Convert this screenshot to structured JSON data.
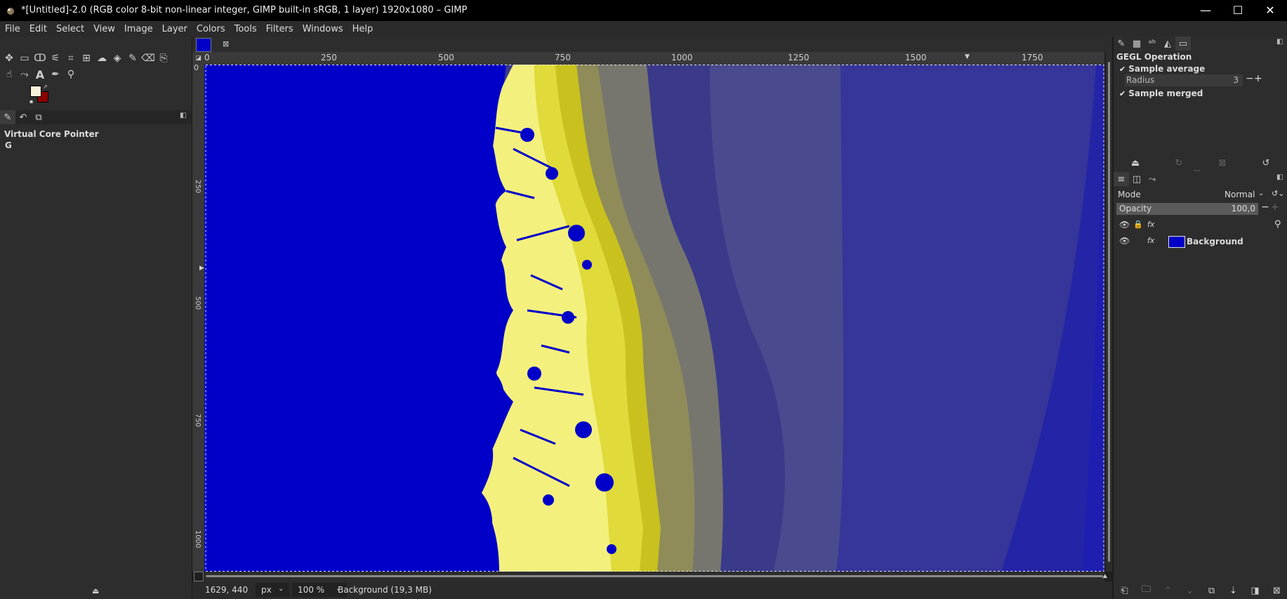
{
  "window": {
    "title": "*[Untitled]-2.0 (RGB color 8-bit non-linear integer, GIMP built-in sRGB, 1 layer) 1920x1080 – GIMP",
    "minimize": "—",
    "maximize": "☐",
    "close": "✕"
  },
  "menu": [
    "File",
    "Edit",
    "Select",
    "View",
    "Image",
    "Layer",
    "Colors",
    "Tools",
    "Filters",
    "Windows",
    "Help"
  ],
  "toolbox": {
    "device_status_title": "Virtual Core Pointer",
    "device_status_icon": "G"
  },
  "ruler": {
    "top_labels": [
      "0",
      "250",
      "500",
      "750",
      "1000",
      "1250",
      "1500",
      "1750"
    ],
    "left_labels": [
      "0",
      "250",
      "500",
      "750",
      "1000"
    ]
  },
  "status": {
    "coords": "1629, 440",
    "unit": "px",
    "zoom": "100 %",
    "layer_info": "Background (19,3 MB)"
  },
  "gegl": {
    "title": "GEGL Operation",
    "sample_average": "Sample average",
    "radius_label": "Radius",
    "radius_value": "3",
    "sample_merged": "Sample merged"
  },
  "layers": {
    "mode_label": "Mode",
    "mode_value": "Normal",
    "opacity_label": "Opacity",
    "opacity_value": "100,0",
    "layer_name": "Background"
  },
  "colors": {
    "fg": "#f6f1d8",
    "bg": "#8b0000",
    "canvas_blue": "#0000c8"
  }
}
